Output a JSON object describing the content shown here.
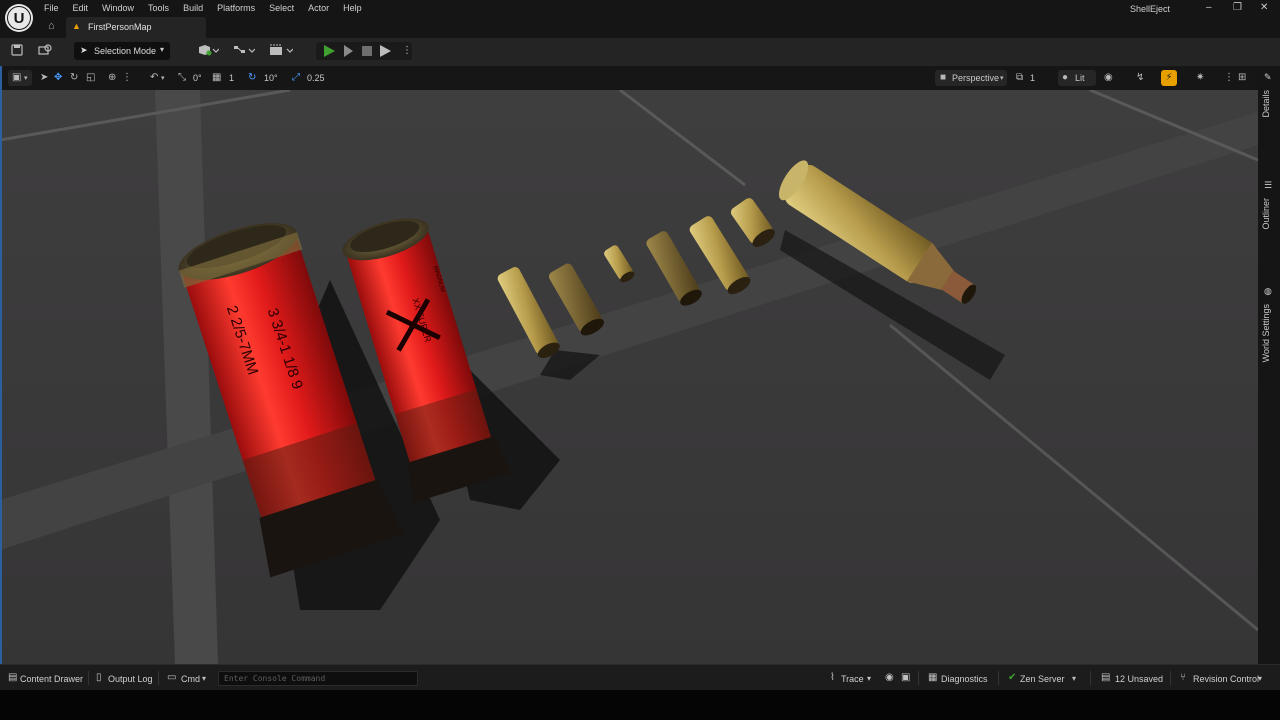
{
  "window": {
    "app_title": "ShellEject",
    "menu": [
      "File",
      "Edit",
      "Window",
      "Tools",
      "Build",
      "Platforms",
      "Select",
      "Actor",
      "Help"
    ],
    "document_tab": "FirstPersonMap",
    "controls": {
      "minimize": "–",
      "restore": "❐",
      "close": "✕"
    }
  },
  "toolbar": {
    "selection_mode": "Selection Mode",
    "icons": [
      "save-icon",
      "content-browser-icon",
      "add-actor-icon",
      "blueprint-icon",
      "cinematics-icon",
      "play-icon",
      "advance-frame-icon",
      "stop-icon",
      "launch-icon",
      "more-options-icon"
    ]
  },
  "viewport_toolbar": {
    "rotation_snap_value": "0°",
    "grid_value": "1",
    "angle_snap_value": "10°",
    "scale_snap_value": "0.25",
    "view_mode": "Perspective",
    "camera_speed": "1",
    "lighting_mode": "Lit"
  },
  "side_panels": [
    "Details",
    "Outliner",
    "World Settings"
  ],
  "shotgun_shells": [
    {
      "top_text": "2 2/5-7MM",
      "bottom_text": "3 3/4-1 1/8 9"
    },
    {
      "brand_text": "XX SUPER",
      "small_text": "MAGNUM"
    }
  ],
  "colors": {
    "accent_orange": "#e8a000",
    "play_green": "#3fa12f",
    "shell_red": "#e01a1a",
    "brass": "#b59a4a",
    "floor": "#3b3a3b",
    "grid_line": "#5a595a",
    "viewport_border": "#2a5fa0"
  },
  "statusbar": {
    "content_drawer": "Content Drawer",
    "output_log": "Output Log",
    "cmd": "Cmd",
    "console_placeholder": "Enter Console Command",
    "trace": "Trace",
    "diagnostics": "Diagnostics",
    "zen_server": "Zen Server",
    "unsaved": "12 Unsaved",
    "revision_control": "Revision Control"
  }
}
